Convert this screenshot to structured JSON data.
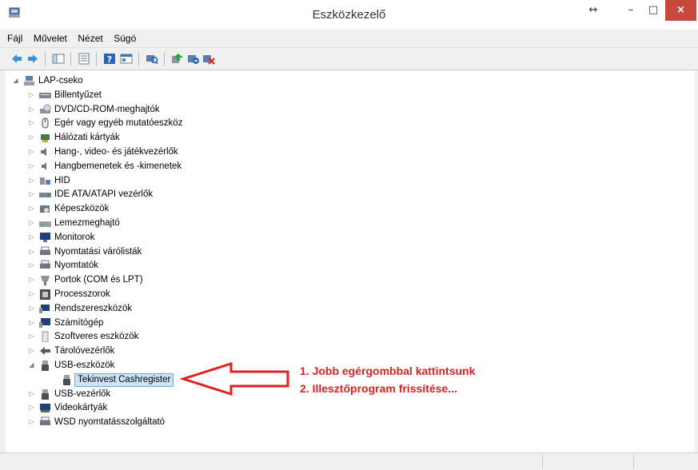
{
  "window": {
    "title": "Eszközkezelő",
    "controls": {
      "resize": "↔",
      "minimize": "–",
      "maximize": "□",
      "close": "×"
    }
  },
  "menu": [
    "Fájl",
    "Művelet",
    "Nézet",
    "Súgó"
  ],
  "toolbar_icons": [
    "back-arrow-icon",
    "forward-arrow-icon",
    "show-hide-tree-icon",
    "properties-icon",
    "help-icon",
    "view-icon",
    "scan-hardware-icon",
    "update-driver-icon",
    "disable-device-icon",
    "uninstall-device-icon"
  ],
  "tree": {
    "root": {
      "label": "LAP-cseko",
      "icon": "computer-icon",
      "expanded": true
    },
    "categories": [
      {
        "label": "Billentyűzet",
        "icon": "keyboard-icon"
      },
      {
        "label": "DVD/CD-ROM-meghajtók",
        "icon": "dvd-drive-icon"
      },
      {
        "label": "Egér vagy egyéb mutatóeszköz",
        "icon": "mouse-icon"
      },
      {
        "label": "Hálózati kártyák",
        "icon": "network-adapter-icon"
      },
      {
        "label": "Hang-, video- és játékvezérlők",
        "icon": "speaker-icon"
      },
      {
        "label": "Hangbemenetek és -kimenetek",
        "icon": "audio-io-icon"
      },
      {
        "label": "HID",
        "icon": "hid-icon"
      },
      {
        "label": "IDE ATA/ATAPI vezérlők",
        "icon": "ide-controller-icon"
      },
      {
        "label": "Képeszközök",
        "icon": "imaging-device-icon"
      },
      {
        "label": "Lemezmeghajtó",
        "icon": "disk-drive-icon"
      },
      {
        "label": "Monitorok",
        "icon": "monitor-icon"
      },
      {
        "label": "Nyomtatási várólisták",
        "icon": "print-queue-icon"
      },
      {
        "label": "Nyomtatók",
        "icon": "printer-icon"
      },
      {
        "label": "Portok (COM és LPT)",
        "icon": "port-icon"
      },
      {
        "label": "Processzorok",
        "icon": "processor-icon"
      },
      {
        "label": "Rendszereszközök",
        "icon": "system-device-icon"
      },
      {
        "label": "Számítógép",
        "icon": "computer-category-icon"
      },
      {
        "label": "Szoftveres eszközök",
        "icon": "software-device-icon"
      },
      {
        "label": "Tárolóvezérlők",
        "icon": "storage-controller-icon"
      },
      {
        "label": "USB-eszközök",
        "icon": "usb-device-icon",
        "expanded": true,
        "children": [
          {
            "label": "Tekinvest Cashregister",
            "icon": "usb-device-icon",
            "selected": true
          }
        ]
      },
      {
        "label": "USB-vezérlők",
        "icon": "usb-controller-icon"
      },
      {
        "label": "Videokártyák",
        "icon": "display-adapter-icon"
      },
      {
        "label": "WSD nyomtatásszolgáltató",
        "icon": "wsd-printer-icon"
      }
    ]
  },
  "annotation": {
    "line1": "1. Jobb egérgombbal kattintsunk",
    "line2": "2. Illesztőprogram frissítése...",
    "color": "#e02020"
  }
}
